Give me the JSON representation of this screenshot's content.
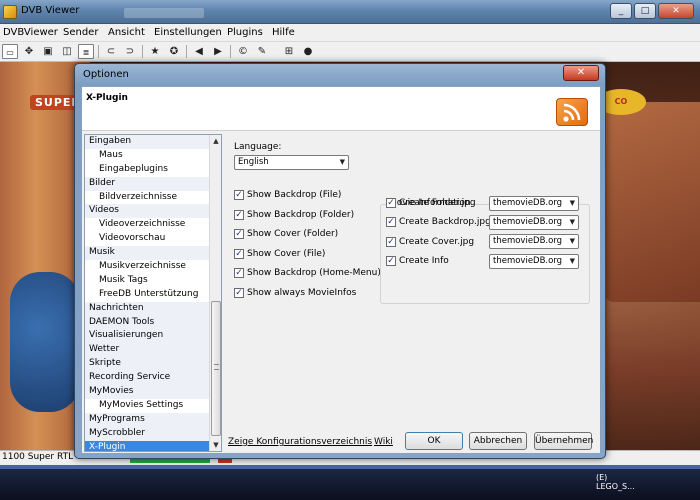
{
  "app": {
    "title": "DVB Viewer",
    "menu": [
      "DVBViewer",
      "Sender",
      "Ansicht",
      "Einstellungen",
      "Plugins",
      "Hilfe"
    ],
    "window_controls": [
      "_",
      "□",
      "✕"
    ],
    "video_logo": "SUPER",
    "video_badge": "CO",
    "status_channel": "1100 Super RTL",
    "taskbar_thumb": "(E) LEGO_S..."
  },
  "dialog": {
    "title": "Optionen",
    "close": "✕",
    "header": "X-Plugin",
    "nav_items": [
      {
        "label": "Eingaben",
        "level": "cat"
      },
      {
        "label": "Maus",
        "level": "sub"
      },
      {
        "label": "Eingabeplugins",
        "level": "sub"
      },
      {
        "label": "Bilder",
        "level": "cat"
      },
      {
        "label": "Bildverzeichnisse",
        "level": "sub"
      },
      {
        "label": "Videos",
        "level": "cat"
      },
      {
        "label": "Videoverzeichnisse",
        "level": "sub"
      },
      {
        "label": "Videovorschau",
        "level": "sub"
      },
      {
        "label": "Musik",
        "level": "cat"
      },
      {
        "label": "Musikverzeichnisse",
        "level": "sub"
      },
      {
        "label": "Musik Tags",
        "level": "sub"
      },
      {
        "label": "FreeDB Unterstützung",
        "level": "sub"
      },
      {
        "label": "Nachrichten",
        "level": "cat"
      },
      {
        "label": "DAEMON Tools",
        "level": "cat"
      },
      {
        "label": "Visualisierungen",
        "level": "cat"
      },
      {
        "label": "Wetter",
        "level": "cat"
      },
      {
        "label": "Skripte",
        "level": "cat"
      },
      {
        "label": "Recording Service",
        "level": "cat"
      },
      {
        "label": "MyMovies",
        "level": "cat"
      },
      {
        "label": "MyMovies Settings",
        "level": "sub"
      },
      {
        "label": "MyPrograms",
        "level": "cat"
      },
      {
        "label": "MyScrobbler",
        "level": "cat"
      },
      {
        "label": "X-Plugin",
        "level": "cat",
        "selected": true
      }
    ],
    "language_label": "Language:",
    "language_value": "English",
    "checkboxes": [
      {
        "label": "Show Backdrop (File)",
        "checked": true
      },
      {
        "label": "Show Backdrop (Folder)",
        "checked": true
      },
      {
        "label": "Show Cover (Folder)",
        "checked": true
      },
      {
        "label": "Show Cover (File)",
        "checked": true
      },
      {
        "label": "Show Backdrop (Home-Menu)",
        "checked": true
      },
      {
        "label": "Show always MovieInfos",
        "checked": true
      }
    ],
    "movie_info": {
      "legend": "Movie Information",
      "rows": [
        {
          "label": "Create Folder.jpg",
          "checked": true,
          "source": "themovieDB.org"
        },
        {
          "label": "Create Backdrop.jpg",
          "checked": true,
          "source": "themovieDB.org"
        },
        {
          "label": "Create Cover.jpg",
          "checked": true,
          "source": "themovieDB.org"
        },
        {
          "label": "Create Info",
          "checked": true,
          "source": "themovieDB.org"
        }
      ]
    },
    "links": {
      "config_dir": "Zeige Konfigurationsverzeichnis",
      "wiki": "Wiki"
    },
    "buttons": {
      "ok": "OK",
      "cancel": "Abbrechen",
      "apply": "Übernehmen"
    }
  }
}
